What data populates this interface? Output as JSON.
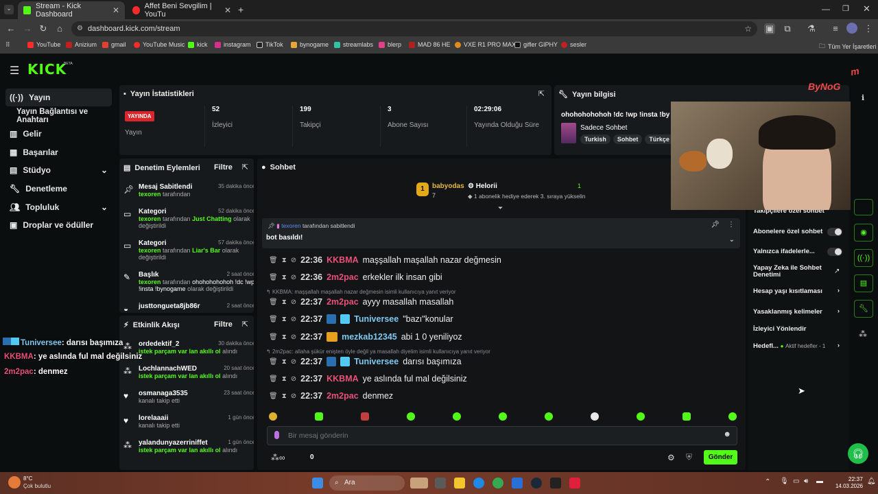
{
  "browser": {
    "tabs": [
      {
        "title": "Stream - Kick Dashboard",
        "color": "#53fc18"
      },
      {
        "title": "Affet Beni Sevgilim | YouTu",
        "color": "#ff2a2a"
      }
    ],
    "url": "dashboard.kick.com/stream",
    "bookmarks": [
      "YouTube",
      "Anizium",
      "gmail",
      "YouTube Music",
      "kick",
      "instagram",
      "TikTok",
      "bynogame",
      "streamlabs",
      "blerp",
      "MAD 86 HE",
      "VXE R1 PRO MAX",
      "gifler GIPHY",
      "sesler"
    ],
    "all_bookmarks": "Tüm Yer İşaretleri"
  },
  "kick": {
    "logo": "KICK",
    "beta": "BETA",
    "nav": [
      {
        "label": "Yayın",
        "icon": "broadcast-icon"
      },
      {
        "label": "Yayın Bağlantısı ve Anahtarı",
        "icon": ""
      },
      {
        "label": "Gelir",
        "icon": "wallet-icon"
      },
      {
        "label": "Başarılar",
        "icon": "trophy-icon"
      },
      {
        "label": "Stüdyo",
        "icon": "studio-icon"
      },
      {
        "label": "Denetleme",
        "icon": "wrench-icon"
      },
      {
        "label": "Topluluk",
        "icon": "community-icon"
      },
      {
        "label": "Droplar ve ödüller",
        "icon": "gift-icon"
      }
    ],
    "stats": {
      "title": "Yayın İstatistikleri",
      "status": "YAYINDA",
      "status_label": "Yayın",
      "viewers": "52",
      "viewers_label": "İzleyici",
      "followers": "199",
      "followers_label": "Takipçi",
      "subs": "3",
      "subs_label": "Abone Sayısı",
      "uptime": "02:29:06",
      "uptime_label": "Yayında Olduğu Süre"
    },
    "info": {
      "title": "Yayın bilgisi",
      "stream_title": "ohohohohohoh !dc !wp !insta !by",
      "category": "Sadece Sohbet",
      "tags": [
        "Turkish",
        "Sohbet",
        "Türkçe"
      ]
    },
    "mod": {
      "title": "Denetim Eylemleri",
      "filter": "Filtre",
      "items": [
        {
          "title": "Mesaj Sabitlendi",
          "user": "texoren",
          "text": "tarafından",
          "ago": "35 dakika önce"
        },
        {
          "title": "Kategori",
          "user": "texoren",
          "text": "tarafından",
          "extra": "Just Chatting",
          "tail": "olarak değiştirildi",
          "ago": "52 dakika önce"
        },
        {
          "title": "Kategori",
          "user": "texoren",
          "text": "tarafından",
          "extra": "Liar's Bar",
          "tail": "olarak değiştirildi",
          "ago": "57 dakika önce"
        },
        {
          "title": "Başlık",
          "user": "texoren",
          "text": "tarafından",
          "extra": "ohohohohohoh !dc !wp !insta !bynogame",
          "tail": "olarak değiştirildi",
          "ago": "2 saat önce"
        },
        {
          "title": "justtongueta8jb86r",
          "ago": "2 saat önce"
        }
      ]
    },
    "activity": {
      "title": "Etkinlik Akışı",
      "filter": "Filtre",
      "items": [
        {
          "user": "ordedektif_2",
          "text": "istek parçam var lan akıllı ol",
          "tail": "alındı",
          "ago": "30 dakika önce"
        },
        {
          "user": "LochlannachWED",
          "text": "istek parçam var lan akıllı ol",
          "tail": "alındı",
          "ago": "20 saat önce"
        },
        {
          "user": "osmanaga3535",
          "text": "kanalı takip etti",
          "ago": "23 saat önce"
        },
        {
          "user": "lorelaaaii",
          "text": "kanalı takip etti",
          "ago": "1 gün önce"
        },
        {
          "user": "yalandunyazerriniffet",
          "text": "istek parçam var lan akıllı ol",
          "tail": "alındı",
          "ago": "1 gün önce"
        }
      ]
    },
    "chat": {
      "title": "Sohbet",
      "top_gifter": {
        "name": "babyodas",
        "count": "7",
        "rank": "1"
      },
      "event_user": "Helorii",
      "event_count": "1",
      "event_text": "1 abonelik hediye ederek 3. sıraya yükselin",
      "pinned": {
        "user": "texoren",
        "by": "tarafından sabitlendi",
        "message": "bot basıldı!"
      },
      "messages": [
        {
          "time": "22:36",
          "user": "KKBMA",
          "color": "#e8507a",
          "text": "maşşallah maşallah nazar değmesin"
        },
        {
          "time": "22:36",
          "user": "2m2pac",
          "color": "#e8507a",
          "text": "erkekler ilk insan gibi"
        },
        {
          "reply": "KKBMA: maşşallah maşallah nazar değmesin isimli kullanıcıya yanıt veriyor"
        },
        {
          "time": "22:37",
          "user": "2m2pac",
          "color": "#e8507a",
          "text": "ayyy masallah masallah"
        },
        {
          "time": "22:37",
          "user": "Tuniversee",
          "color": "#7ec8f0",
          "text": "\"bazı\"konular"
        },
        {
          "time": "22:37",
          "user": "mezkab12345",
          "color": "#7ec8f0",
          "text": "abi 1 0 yeniliyoz"
        },
        {
          "reply": "2m2pac: allaha şükür enişten öyle değil ya masallah diyelim isimli kullanıcıya yanıt veriyor"
        },
        {
          "time": "22:37",
          "user": "Tuniversee",
          "color": "#7ec8f0",
          "text": "darısı başımıza"
        },
        {
          "time": "22:37",
          "user": "KKBMA",
          "color": "#e8507a",
          "text": "ye aslında ful mal değilsiniz"
        },
        {
          "time": "22:37",
          "user": "2m2pac",
          "color": "#e8507a",
          "text": "denmez"
        }
      ],
      "placeholder": "Bir mesaj gönderin",
      "points": "0",
      "send": "Gönder"
    },
    "right": {
      "items": [
        "Takipçilere özel sohbet",
        "Abonelere özel sohbet",
        "Yalnızca ifadelerle...",
        "Yapay Zeka ile Sohbet Denetimi",
        "Hesap yaşı kısıtlaması",
        "Yasaklanmış kelimeler",
        "İzleyici Yönlendir",
        "Hedefl..."
      ],
      "goals": "Aktif hedefler - 1"
    }
  },
  "overlay": {
    "lines": [
      {
        "user": "Tuniversee",
        "color": "#7ec8f0",
        "text": ": darısı başımıza"
      },
      {
        "user": "KKBMA",
        "color": "#e8507a",
        "text": ": ye aslında ful mal değilsiniz"
      },
      {
        "user": "2m2pac",
        "color": "#e8507a",
        "text": ": denmez"
      }
    ],
    "watermark": "ByNoG"
  },
  "taskbar": {
    "temp": "8°C",
    "weather": "Çok bulutlu",
    "search": "Ara",
    "time": "22:37",
    "date": "14.03.2026"
  },
  "colors": {
    "accent": "#53fc18",
    "live": "#d9262c"
  }
}
